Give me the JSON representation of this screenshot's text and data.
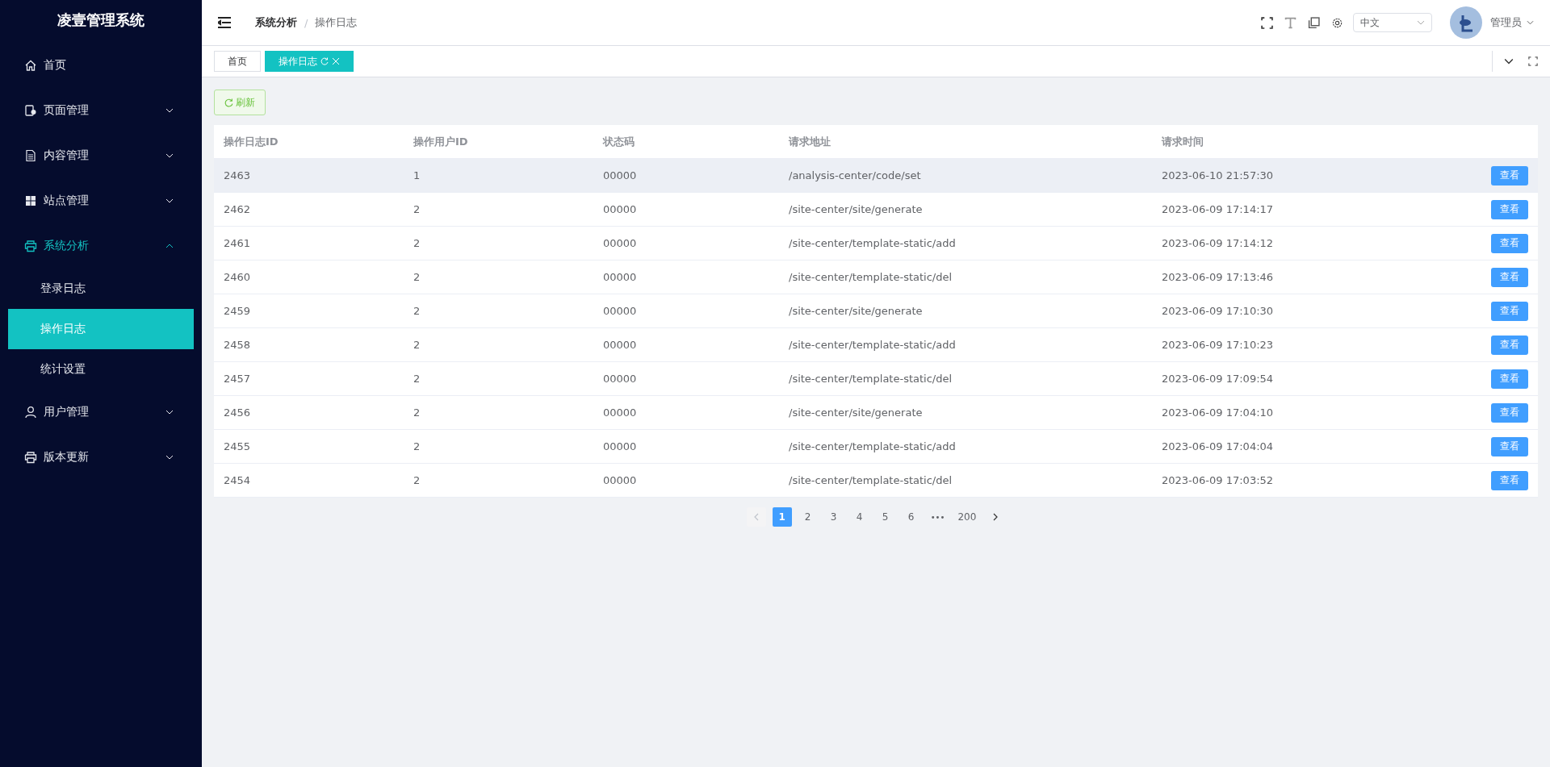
{
  "sidebar": {
    "title": "凌壹管理系统",
    "items": [
      {
        "label": "首页",
        "kind": "link",
        "expanded": false
      },
      {
        "label": "页面管理",
        "kind": "submenu",
        "expanded": false
      },
      {
        "label": "内容管理",
        "kind": "submenu",
        "expanded": false
      },
      {
        "label": "站点管理",
        "kind": "submenu",
        "expanded": false
      },
      {
        "label": "系统分析",
        "kind": "submenu",
        "expanded": true,
        "children": [
          {
            "label": "登录日志",
            "selected": false
          },
          {
            "label": "操作日志",
            "selected": true
          },
          {
            "label": "统计设置",
            "selected": false
          }
        ]
      },
      {
        "label": "用户管理",
        "kind": "submenu",
        "expanded": false
      },
      {
        "label": "版本更新",
        "kind": "submenu",
        "expanded": false
      }
    ]
  },
  "header": {
    "breadcrumb": [
      "系统分析",
      "操作日志"
    ],
    "separator": "/",
    "language": "中文",
    "user": "管理员"
  },
  "tabs": [
    {
      "label": "首页",
      "selected": false
    },
    {
      "label": "操作日志",
      "selected": true
    }
  ],
  "refresh_button": "刷新",
  "table": {
    "columns": [
      "操作日志ID",
      "操作用户ID",
      "状态码",
      "请求地址",
      "请求时间"
    ],
    "rows": [
      {
        "cells": [
          "2463",
          "1",
          "00000",
          "/analysis-center/code/set",
          "2023-06-10 21:57:30"
        ],
        "action": "查看",
        "highlighted": true
      },
      {
        "cells": [
          "2462",
          "2",
          "00000",
          "/site-center/site/generate",
          "2023-06-09 17:14:17"
        ],
        "action": "查看",
        "highlighted": false
      },
      {
        "cells": [
          "2461",
          "2",
          "00000",
          "/site-center/template-static/add",
          "2023-06-09 17:14:12"
        ],
        "action": "查看",
        "highlighted": false
      },
      {
        "cells": [
          "2460",
          "2",
          "00000",
          "/site-center/template-static/del",
          "2023-06-09 17:13:46"
        ],
        "action": "查看",
        "highlighted": false
      },
      {
        "cells": [
          "2459",
          "2",
          "00000",
          "/site-center/site/generate",
          "2023-06-09 17:10:30"
        ],
        "action": "查看",
        "highlighted": false
      },
      {
        "cells": [
          "2458",
          "2",
          "00000",
          "/site-center/template-static/add",
          "2023-06-09 17:10:23"
        ],
        "action": "查看",
        "highlighted": false
      },
      {
        "cells": [
          "2457",
          "2",
          "00000",
          "/site-center/template-static/del",
          "2023-06-09 17:09:54"
        ],
        "action": "查看",
        "highlighted": false
      },
      {
        "cells": [
          "2456",
          "2",
          "00000",
          "/site-center/site/generate",
          "2023-06-09 17:04:10"
        ],
        "action": "查看",
        "highlighted": false
      },
      {
        "cells": [
          "2455",
          "2",
          "00000",
          "/site-center/template-static/add",
          "2023-06-09 17:04:04"
        ],
        "action": "查看",
        "highlighted": false
      },
      {
        "cells": [
          "2454",
          "2",
          "00000",
          "/site-center/template-static/del",
          "2023-06-09 17:03:52"
        ],
        "action": "查看",
        "highlighted": false
      }
    ]
  },
  "pagination": {
    "prev_disabled": true,
    "pages": [
      {
        "label": "1",
        "kind": "page",
        "selected": true
      },
      {
        "label": "2",
        "kind": "page",
        "selected": false
      },
      {
        "label": "3",
        "kind": "page",
        "selected": false
      },
      {
        "label": "4",
        "kind": "page",
        "selected": false
      },
      {
        "label": "5",
        "kind": "page",
        "selected": false
      },
      {
        "label": "6",
        "kind": "page",
        "selected": false
      },
      {
        "label": "•••",
        "kind": "ellipsis"
      },
      {
        "label": "200",
        "kind": "page",
        "selected": false
      }
    ]
  }
}
